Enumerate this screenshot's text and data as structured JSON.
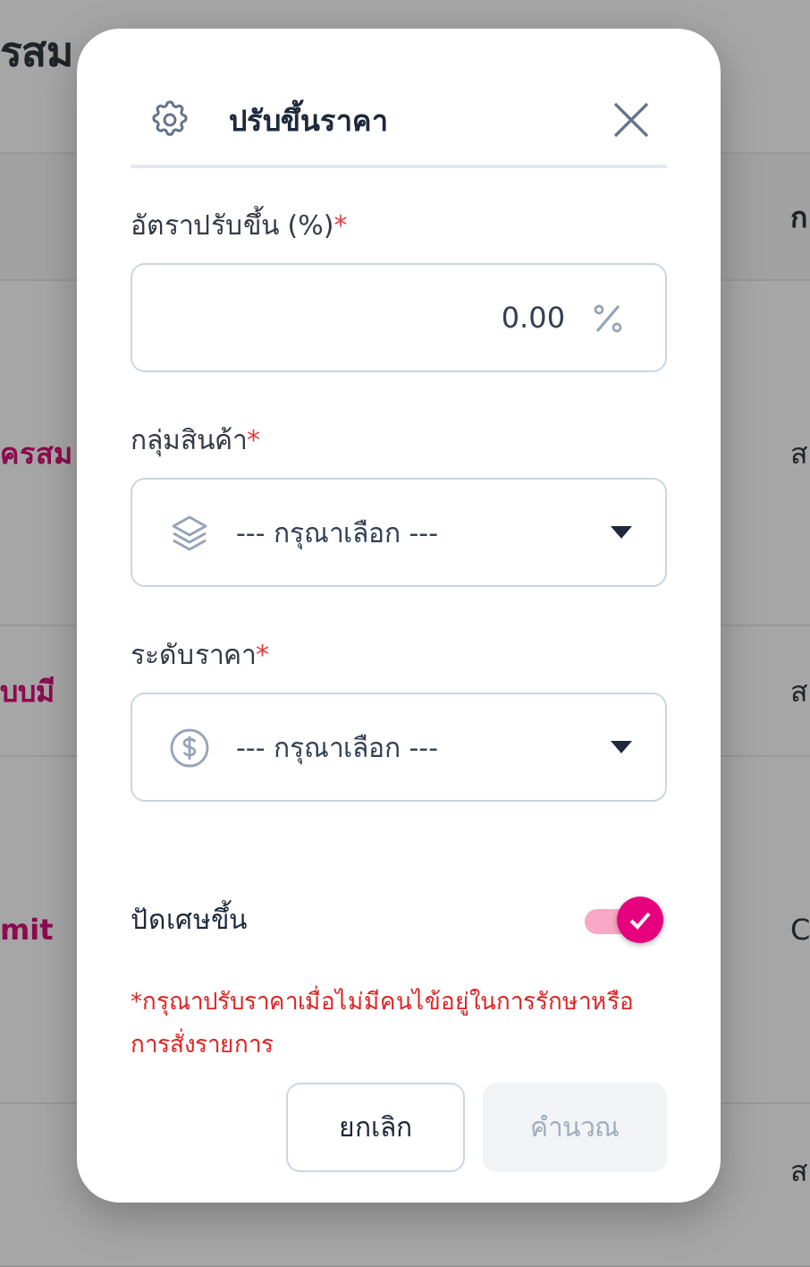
{
  "background": {
    "title": "รสม",
    "header": [
      "ก"
    ],
    "rows": [
      {
        "name": "ครสม",
        "column_2": "ส"
      },
      {
        "name": "บบมี",
        "column_2": "ส"
      },
      {
        "name": "mit",
        "column_2": "C"
      },
      {
        "column_2": "ส"
      }
    ]
  },
  "dialog": {
    "title": "ปรับขึ้นราคา",
    "fields": [
      {
        "kind": "number",
        "label": "อัตราปรับขึ้น (%)",
        "mark": "*",
        "value": "0.00"
      },
      {
        "kind": "select",
        "label": "กลุ่มสินค้า",
        "mark": "*",
        "placeholder": "--- กรุณาเลือก ---"
      },
      {
        "kind": "select",
        "label": "ระดับราคา",
        "mark": "*",
        "placeholder": "--- กรุณาเลือก ---"
      }
    ],
    "toggle": {
      "label": "ปัดเศษขึ้น",
      "on": true
    },
    "note": "*กรุณาปรับราคาเมื่อไม่มีคนไข้อยู่ในการรักษาหรือการสั่งรายการ",
    "buttons": [
      {
        "label": "ยกเลิก",
        "disabled": false
      },
      {
        "label": "คำนวณ",
        "disabled": true
      }
    ]
  }
}
